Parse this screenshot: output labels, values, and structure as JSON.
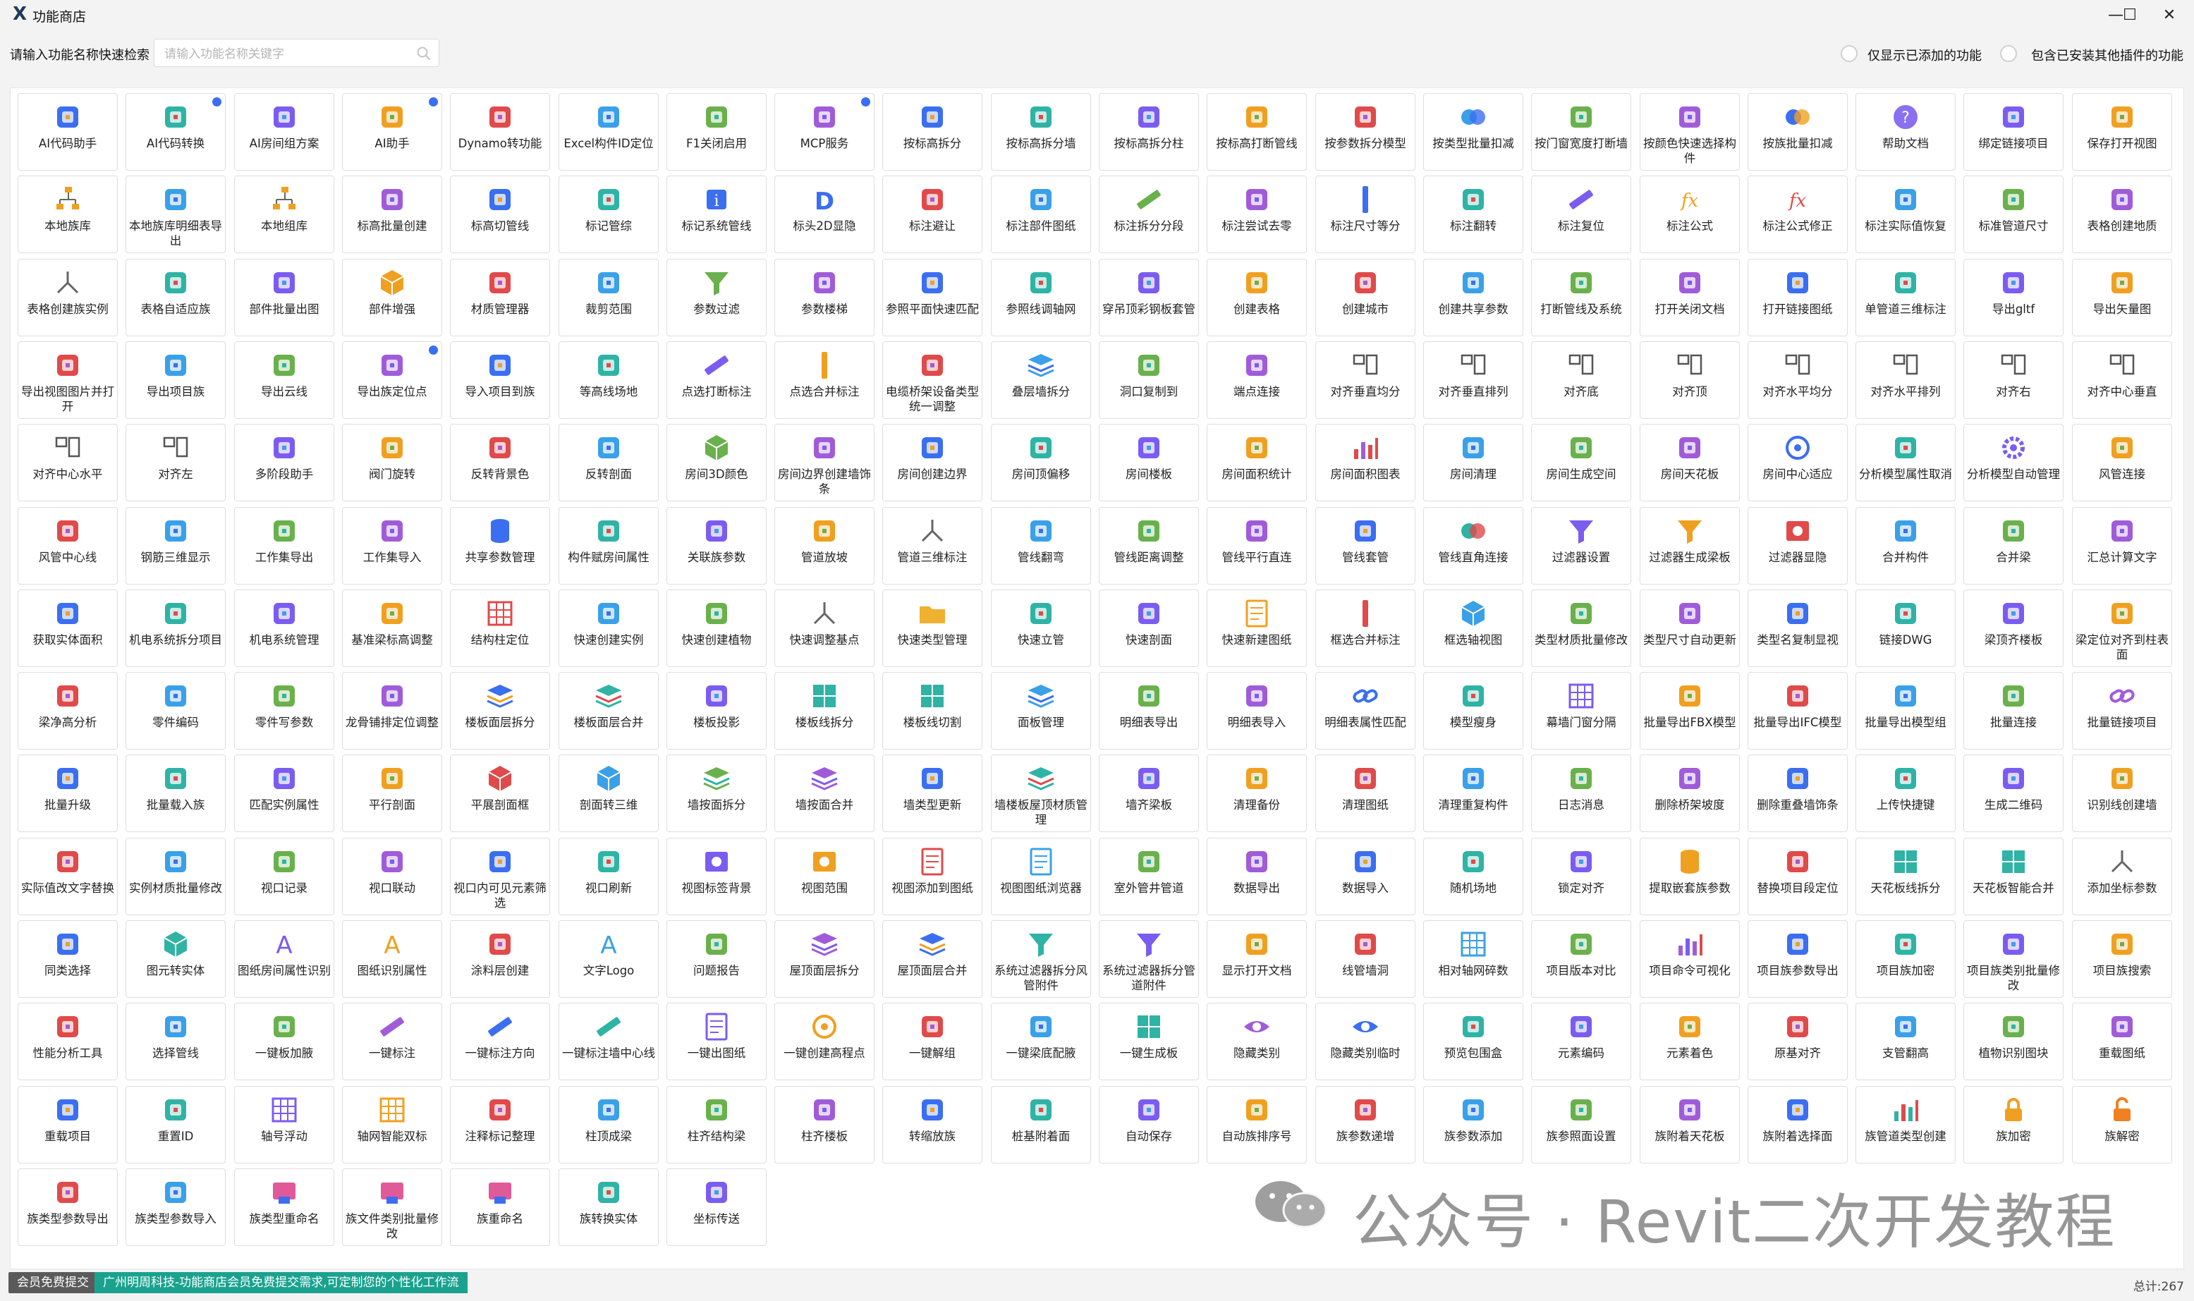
{
  "window": {
    "title": "功能商店",
    "logo": "X",
    "minimize_glyph": "—",
    "maximize_glyph": "☐",
    "close_glyph": "✕"
  },
  "search": {
    "label": "请输入功能名称快速检索",
    "placeholder": "请输入功能名称关键字",
    "value": ""
  },
  "filters": {
    "only_added": "仅显示已添加的功能",
    "include_other_plugins": "包含已安装其他插件的功能"
  },
  "colors": {
    "accent": "#3b6ef0",
    "status_green": "#1aa28f",
    "status_gray": "#5a5a5a"
  },
  "features": [
    {
      "label": "AI代码助手",
      "icon": "chat-robot-icon"
    },
    {
      "label": "AI代码转换",
      "icon": "code-window-icon",
      "badge": true
    },
    {
      "label": "AI房间组方案",
      "icon": "nodes-icon"
    },
    {
      "label": "AI助手",
      "icon": "robot-icon",
      "badge": true
    },
    {
      "label": "Dynamo转功能",
      "icon": "dynamo-icon"
    },
    {
      "label": "Excel构件ID定位",
      "icon": "spreadsheet-icon"
    },
    {
      "label": "F1关闭启用",
      "icon": "f1-key-icon"
    },
    {
      "label": "MCP服务",
      "icon": "mcp-nodes-icon",
      "badge": true
    },
    {
      "label": "按标高拆分",
      "icon": "grid-split-icon"
    },
    {
      "label": "按标高拆分墙",
      "icon": "gear-snow-icon"
    },
    {
      "label": "按标高拆分柱",
      "icon": "gear-snow-icon"
    },
    {
      "label": "按标高打断管线",
      "icon": "vertical-pipe-icon"
    },
    {
      "label": "按参数拆分模型",
      "icon": "cubes-icon"
    },
    {
      "label": "按类型批量扣减",
      "icon": "circles-icon"
    },
    {
      "label": "按门窗宽度打断墙",
      "icon": "door-wall-icon"
    },
    {
      "label": "按颜色快速选择构件",
      "icon": "color-wheel-icon"
    },
    {
      "label": "按族批量扣减",
      "icon": "circles-icon"
    },
    {
      "label": "帮助文档",
      "icon": "help-icon"
    },
    {
      "label": "绑定链接项目",
      "icon": "link-doc-icon"
    },
    {
      "label": "保存打开视图",
      "icon": "ram-icon"
    },
    {
      "label": "本地族库",
      "icon": "tree-icon"
    },
    {
      "label": "本地族库明细表导出",
      "icon": "table-export-icon"
    },
    {
      "label": "本地组库",
      "icon": "tree-icon"
    },
    {
      "label": "标高批量创建",
      "icon": "list-icon"
    },
    {
      "label": "标高切管线",
      "icon": "level-cut-icon"
    },
    {
      "label": "标记管综",
      "icon": "tag-grid-icon"
    },
    {
      "label": "标记系统管线",
      "icon": "info-icon"
    },
    {
      "label": "标头2D显隐",
      "icon": "letter-d-icon"
    },
    {
      "label": "标注避让",
      "icon": "dimension-icon"
    },
    {
      "label": "标注部件图纸",
      "icon": "purple-square-icon"
    },
    {
      "label": "标注拆分分段",
      "icon": "ruler-icon"
    },
    {
      "label": "标注尝试去零",
      "icon": "wave-icon"
    },
    {
      "label": "标注尺寸等分",
      "icon": "vertical-ruler-icon"
    },
    {
      "label": "标注翻转",
      "icon": "flip-icon"
    },
    {
      "label": "标注复位",
      "icon": "ruler-icon"
    },
    {
      "label": "标注公式",
      "icon": "fx-icon"
    },
    {
      "label": "标注公式修正",
      "icon": "fx-icon"
    },
    {
      "label": "标注实际值恢复",
      "icon": "shuffle-icon"
    },
    {
      "label": "标准管道尺寸",
      "icon": "gauge-icon"
    },
    {
      "label": "表格创建地质",
      "icon": "table-icon"
    },
    {
      "label": "表格创建族实例",
      "icon": "tripod-icon"
    },
    {
      "label": "表格自适应族",
      "icon": "table-x-icon"
    },
    {
      "label": "部件批量出图",
      "icon": "frame-icon"
    },
    {
      "label": "部件增强",
      "icon": "cube-icon"
    },
    {
      "label": "材质管理器",
      "icon": "material-icon"
    },
    {
      "label": "裁剪范围",
      "icon": "crop-icon"
    },
    {
      "label": "参数过滤",
      "icon": "filter-icon"
    },
    {
      "label": "参数楼梯",
      "icon": "stairs-icon"
    },
    {
      "label": "参照平面快速匹配",
      "icon": "hatch-icon"
    },
    {
      "label": "参照线调轴网",
      "icon": "list-icon"
    },
    {
      "label": "穿吊顶彩钢板套管",
      "icon": "compass-icon"
    },
    {
      "label": "创建表格",
      "icon": "xls-icon"
    },
    {
      "label": "创建城市",
      "icon": "map-icon"
    },
    {
      "label": "创建共享参数",
      "icon": "share-icon"
    },
    {
      "label": "打断管线及系统",
      "icon": "pin-icon"
    },
    {
      "label": "打开关闭文档",
      "icon": "door-exit-icon"
    },
    {
      "label": "打开链接图纸",
      "icon": "link-drawing-icon"
    },
    {
      "label": "单管道三维标注",
      "icon": "ladder-icon"
    },
    {
      "label": "导出gltf",
      "icon": "export-icon"
    },
    {
      "label": "导出矢量图",
      "icon": "camera-icon"
    },
    {
      "label": "导出视图图片并打开",
      "icon": "image-icon"
    },
    {
      "label": "导出项目族",
      "icon": "box-icon"
    },
    {
      "label": "导出云线",
      "icon": "cloud-upload-icon"
    },
    {
      "label": "导出族定位点",
      "icon": "dots-icon",
      "badge": true
    },
    {
      "label": "导入项目到族",
      "icon": "import-icon"
    },
    {
      "label": "等高线场地",
      "icon": "contour-icon"
    },
    {
      "label": "点选打断标注",
      "icon": "ruler-icon"
    },
    {
      "label": "点选合并标注",
      "icon": "vertical-ruler-icon"
    },
    {
      "label": "电缆桥架设备类型统一调整",
      "icon": "hammer-icon"
    },
    {
      "label": "叠层墙拆分",
      "icon": "layers-icon"
    },
    {
      "label": "洞口复制到",
      "icon": "dashed-square-icon"
    },
    {
      "label": "端点连接",
      "icon": "t-bar-icon"
    },
    {
      "label": "对齐垂直均分",
      "icon": "align-icon"
    },
    {
      "label": "对齐垂直排列",
      "icon": "align-icon"
    },
    {
      "label": "对齐底",
      "icon": "align-icon"
    },
    {
      "label": "对齐顶",
      "icon": "align-icon"
    },
    {
      "label": "对齐水平均分",
      "icon": "align-icon"
    },
    {
      "label": "对齐水平排列",
      "icon": "align-icon"
    },
    {
      "label": "对齐右",
      "icon": "align-icon"
    },
    {
      "label": "对齐中心垂直",
      "icon": "align-icon"
    },
    {
      "label": "对齐中心水平",
      "icon": "align-icon"
    },
    {
      "label": "对齐左",
      "icon": "align-icon"
    },
    {
      "label": "多阶段助手",
      "icon": "stack-icon"
    },
    {
      "label": "阀门旋转",
      "icon": "valve-icon"
    },
    {
      "label": "反转背景色",
      "icon": "contrast-icon"
    },
    {
      "label": "反转剖面",
      "icon": "bowtie-icon"
    },
    {
      "label": "房间3D颜色",
      "icon": "cube-icon"
    },
    {
      "label": "房间边界创建墙饰条",
      "icon": "room-icon"
    },
    {
      "label": "房间创建边界",
      "icon": "square-outline-icon"
    },
    {
      "label": "房间顶偏移",
      "icon": "chevron-up-icon"
    },
    {
      "label": "房间楼板",
      "icon": "room-icon"
    },
    {
      "label": "房间面积统计",
      "icon": "clipboard-icon"
    },
    {
      "label": "房间面积图表",
      "icon": "chart-icon"
    },
    {
      "label": "房间清理",
      "icon": "brush-icon"
    },
    {
      "label": "房间生成空间",
      "icon": "space-icon"
    },
    {
      "label": "房间天花板",
      "icon": "room-icon"
    },
    {
      "label": "房间中心适应",
      "icon": "target-icon"
    },
    {
      "label": "分析模型属性取消",
      "icon": "x-box-icon"
    },
    {
      "label": "分析模型自动管理",
      "icon": "gear-icon"
    },
    {
      "label": "风管连接",
      "icon": "t-bar-icon"
    },
    {
      "label": "风管中心线",
      "icon": "panel-icon"
    },
    {
      "label": "钢筋三维显示",
      "icon": "rebar-icon"
    },
    {
      "label": "工作集导出",
      "icon": "wrench-icon"
    },
    {
      "label": "工作集导入",
      "icon": "wrench-icon"
    },
    {
      "label": "共享参数管理",
      "icon": "database-icon"
    },
    {
      "label": "构件赋房间属性",
      "icon": "house-icon"
    },
    {
      "label": "关联族参数",
      "icon": "calc-icon"
    },
    {
      "label": "管道放坡",
      "icon": "slope-icon"
    },
    {
      "label": "管道三维标注",
      "icon": "tripod-icon"
    },
    {
      "label": "管线翻弯",
      "icon": "bend-icon"
    },
    {
      "label": "管线距离调整",
      "icon": "distance-icon"
    },
    {
      "label": "管线平行直连",
      "icon": "navigate-icon"
    },
    {
      "label": "管线套管",
      "icon": "ring-icon"
    },
    {
      "label": "管线直角连接",
      "icon": "circles-icon"
    },
    {
      "label": "过滤器设置",
      "icon": "filter-icon"
    },
    {
      "label": "过滤器生成梁板",
      "icon": "filter-icon"
    },
    {
      "label": "过滤器显隐",
      "icon": "view-icon"
    },
    {
      "label": "合并构件",
      "icon": "merge-icon"
    },
    {
      "label": "合并梁",
      "icon": "beam-icon"
    },
    {
      "label": "汇总计算文字",
      "icon": "book-icon"
    },
    {
      "label": "获取实体面积",
      "icon": "hatch-icon"
    },
    {
      "label": "机电系统拆分项目",
      "icon": "modules-icon"
    },
    {
      "label": "机电系统管理",
      "icon": "system-icon"
    },
    {
      "label": "基准梁标高调整",
      "icon": "arrow-down-icon"
    },
    {
      "label": "结构柱定位",
      "icon": "grid-icon"
    },
    {
      "label": "快速创建实例",
      "icon": "dots-icon"
    },
    {
      "label": "快速创建植物",
      "icon": "plant-icon"
    },
    {
      "label": "快速调整基点",
      "icon": "tripod-icon"
    },
    {
      "label": "快速类型管理",
      "icon": "folder-icon"
    },
    {
      "label": "快速立管",
      "icon": "pipe-icon"
    },
    {
      "label": "快速剖面",
      "icon": "section-icon"
    },
    {
      "label": "快速新建图纸",
      "icon": "sheet-icon"
    },
    {
      "label": "框选合并标注",
      "icon": "vertical-ruler-icon"
    },
    {
      "label": "框选轴视图",
      "icon": "cube-icon"
    },
    {
      "label": "类型材质批量修改",
      "icon": "triangles-icon"
    },
    {
      "label": "类型尺寸自动更新",
      "icon": "monitor-icon"
    },
    {
      "label": "类型名复制显视",
      "icon": "copy-icon"
    },
    {
      "label": "链接DWG",
      "icon": "dwg-icon"
    },
    {
      "label": "梁顶齐楼板",
      "icon": "beam-icon"
    },
    {
      "label": "梁定位对齐到柱表面",
      "icon": "column-icon"
    },
    {
      "label": "梁净高分析",
      "icon": "height-icon"
    },
    {
      "label": "零件编码",
      "icon": "compass-icon"
    },
    {
      "label": "零件写参数",
      "icon": "compass-icon"
    },
    {
      "label": "龙骨铺排定位调整",
      "icon": "diamond-arrow-icon"
    },
    {
      "label": "楼板面层拆分",
      "icon": "layers-icon"
    },
    {
      "label": "楼板面层合并",
      "icon": "layers-icon"
    },
    {
      "label": "楼板投影",
      "icon": "compass-icon"
    },
    {
      "label": "楼板线拆分",
      "icon": "slab-icon"
    },
    {
      "label": "楼板线切割",
      "icon": "slab-icon"
    },
    {
      "label": "面板管理",
      "icon": "layers-icon"
    },
    {
      "label": "明细表导出",
      "icon": "excel-icon"
    },
    {
      "label": "明细表导入",
      "icon": "excel-icon"
    },
    {
      "label": "明细表属性匹配",
      "icon": "link-icon"
    },
    {
      "label": "模型瘦身",
      "icon": "brush-icon"
    },
    {
      "label": "幕墙门窗分隔",
      "icon": "grid-icon"
    },
    {
      "label": "批量导出FBX模型",
      "icon": "doc-export-icon"
    },
    {
      "label": "批量导出IFC模型",
      "icon": "doc-export-icon"
    },
    {
      "label": "批量导出模型组",
      "icon": "group-icon"
    },
    {
      "label": "批量连接",
      "icon": "pentagon-icon"
    },
    {
      "label": "批量链接项目",
      "icon": "link-icon"
    },
    {
      "label": "批量升级",
      "icon": "upgrade-icon"
    },
    {
      "label": "批量载入族",
      "icon": "download-icon"
    },
    {
      "label": "匹配实例属性",
      "icon": "paintbrush-icon"
    },
    {
      "label": "平行剖面",
      "icon": "parallel-icon"
    },
    {
      "label": "平展剖面框",
      "icon": "cube-icon"
    },
    {
      "label": "剖面转三维",
      "icon": "cube-icon"
    },
    {
      "label": "墙按面拆分",
      "icon": "layers-icon"
    },
    {
      "label": "墙按面合并",
      "icon": "layers-icon"
    },
    {
      "label": "墙类型更新",
      "icon": "wall-icon"
    },
    {
      "label": "墙楼板屋顶材质管理",
      "icon": "layers-icon"
    },
    {
      "label": "墙齐梁板",
      "icon": "bars-icon"
    },
    {
      "label": "清理备份",
      "icon": "monitor-icon"
    },
    {
      "label": "清理图纸",
      "icon": "broom-icon"
    },
    {
      "label": "清理重复构件",
      "icon": "refresh-icon"
    },
    {
      "label": "日志消息",
      "icon": "log-icon"
    },
    {
      "label": "删除桥架坡度",
      "icon": "arrow-circle-icon"
    },
    {
      "label": "删除重叠墙饰条",
      "icon": "trash-icon"
    },
    {
      "label": "上传快捷键",
      "icon": "keyboard-icon"
    },
    {
      "label": "生成二维码",
      "icon": "qrcode-icon"
    },
    {
      "label": "识别线创建墙",
      "icon": "brick-icon"
    },
    {
      "label": "实际值改文字替换",
      "icon": "shuffle-icon"
    },
    {
      "label": "实例材质批量修改",
      "icon": "triangles-icon"
    },
    {
      "label": "视口记录",
      "icon": "viewport-icon"
    },
    {
      "label": "视口联动",
      "icon": "viewport-icon"
    },
    {
      "label": "视口内可见元素筛选",
      "icon": "viewport-icon"
    },
    {
      "label": "视口刷新",
      "icon": "viewport-icon"
    },
    {
      "label": "视图标签背景",
      "icon": "view-icon"
    },
    {
      "label": "视图范围",
      "icon": "view-icon"
    },
    {
      "label": "视图添加到图纸",
      "icon": "sheet-icon"
    },
    {
      "label": "视图图纸浏览器",
      "icon": "sheet-icon"
    },
    {
      "label": "室外管井管道",
      "icon": "well-icon"
    },
    {
      "label": "数据导出",
      "icon": "share-export-icon"
    },
    {
      "label": "数据导入",
      "icon": "share-import-icon"
    },
    {
      "label": "随机场地",
      "icon": "terrain-icon"
    },
    {
      "label": "锁定对齐",
      "icon": "lock-align-icon"
    },
    {
      "label": "提取嵌套族参数",
      "icon": "database-icon"
    },
    {
      "label": "替换项目段定位",
      "icon": "dots-icon"
    },
    {
      "label": "天花板线拆分",
      "icon": "slab-icon"
    },
    {
      "label": "天花板智能合并",
      "icon": "slab-icon"
    },
    {
      "label": "添加坐标参数",
      "icon": "tripod-icon"
    },
    {
      "label": "同类选择",
      "icon": "select-icon"
    },
    {
      "label": "图元转实体",
      "icon": "cube-icon"
    },
    {
      "label": "图纸房间属性识别",
      "icon": "letter-a-icon"
    },
    {
      "label": "图纸识别属性",
      "icon": "letter-a-icon"
    },
    {
      "label": "涂料层创建",
      "icon": "paint-roller-icon"
    },
    {
      "label": "文字Logo",
      "icon": "letter-a-icon"
    },
    {
      "label": "问题报告",
      "icon": "report-icon"
    },
    {
      "label": "屋顶面层拆分",
      "icon": "layers-icon"
    },
    {
      "label": "屋顶面层合并",
      "icon": "layers-icon"
    },
    {
      "label": "系统过滤器拆分风管附件",
      "icon": "filter-icon"
    },
    {
      "label": "系统过滤器拆分管道附件",
      "icon": "filter-icon"
    },
    {
      "label": "显示打开文档",
      "icon": "open-doc-icon"
    },
    {
      "label": "线管墙洞",
      "icon": "monitor-icon"
    },
    {
      "label": "相对轴网碎数",
      "icon": "grid-icon"
    },
    {
      "label": "项目版本对比",
      "icon": "compare-icon"
    },
    {
      "label": "项目命令可视化",
      "icon": "chart-icon"
    },
    {
      "label": "项目族参数导出",
      "icon": "export-icon"
    },
    {
      "label": "项目族加密",
      "icon": "lock-doc-icon"
    },
    {
      "label": "项目族类别批量修改",
      "icon": "diamond-icon"
    },
    {
      "label": "项目族搜索",
      "icon": "search-doc-icon"
    },
    {
      "label": "性能分析工具",
      "icon": "analysis-icon"
    },
    {
      "label": "选择管线",
      "icon": "select-pipe-icon"
    },
    {
      "label": "一键板加腋",
      "icon": "triangle-icon"
    },
    {
      "label": "一键标注",
      "icon": "ruler-icon"
    },
    {
      "label": "一键标注方向",
      "icon": "ruler-icon"
    },
    {
      "label": "一键标注墙中心线",
      "icon": "ruler-icon"
    },
    {
      "label": "一键出图纸",
      "icon": "sheet-icon"
    },
    {
      "label": "一键创建高程点",
      "icon": "target-icon"
    },
    {
      "label": "一键解组",
      "icon": "ungroup-icon"
    },
    {
      "label": "一键梁底配腋",
      "icon": "beam-icon"
    },
    {
      "label": "一键生成板",
      "icon": "slab-icon"
    },
    {
      "label": "隐藏类别",
      "icon": "eye-icon"
    },
    {
      "label": "隐藏类别临时",
      "icon": "eye-icon"
    },
    {
      "label": "预览包围盒",
      "icon": "box-icon"
    },
    {
      "label": "元素编码",
      "icon": "code-box-icon"
    },
    {
      "label": "元素着色",
      "icon": "palette-icon"
    },
    {
      "label": "原基对齐",
      "icon": "crosshair-icon"
    },
    {
      "label": "支管翻高",
      "icon": "branch-icon"
    },
    {
      "label": "植物识别图块",
      "icon": "tree-plant-icon"
    },
    {
      "label": "重载图纸",
      "icon": "reload-icon"
    },
    {
      "label": "重载项目",
      "icon": "reload-icon"
    },
    {
      "label": "重置ID",
      "icon": "fingerprint-icon"
    },
    {
      "label": "轴号浮动",
      "icon": "grid-icon"
    },
    {
      "label": "轴网智能双标",
      "icon": "grid-icon"
    },
    {
      "label": "注释标记整理",
      "icon": "tag-icon"
    },
    {
      "label": "柱顶成梁",
      "icon": "column-icon"
    },
    {
      "label": "柱齐结构梁",
      "icon": "height-icon"
    },
    {
      "label": "柱齐楼板",
      "icon": "height-icon"
    },
    {
      "label": "转缩放族",
      "icon": "scale-icon"
    },
    {
      "label": "桩基附着面",
      "icon": "pile-icon"
    },
    {
      "label": "自动保存",
      "icon": "save-icon"
    },
    {
      "label": "自动族排序号",
      "icon": "braces-icon"
    },
    {
      "label": "族参数递增",
      "icon": "plus-box-icon"
    },
    {
      "label": "族参数添加",
      "icon": "folder-add-icon"
    },
    {
      "label": "族参照面设置",
      "icon": "plane-icon"
    },
    {
      "label": "族附着天花板",
      "icon": "attach-icon"
    },
    {
      "label": "族附着选择面",
      "icon": "attach-icon"
    },
    {
      "label": "族管道类型创建",
      "icon": "chart-icon"
    },
    {
      "label": "族加密",
      "icon": "lock-icon"
    },
    {
      "label": "族解密",
      "icon": "unlock-icon"
    },
    {
      "label": "族类型参数导出",
      "icon": "arrow-up-circle-icon"
    },
    {
      "label": "族类型参数导入",
      "icon": "arrow-down-circle-icon"
    },
    {
      "label": "族类型重命名",
      "icon": "rename-icon"
    },
    {
      "label": "族文件类别批量修改",
      "icon": "rename-icon"
    },
    {
      "label": "族重命名",
      "icon": "rename-icon"
    },
    {
      "label": "族转换实体",
      "icon": "convert-icon"
    },
    {
      "label": "坐标传送",
      "icon": "coord-icon"
    }
  ],
  "watermark": {
    "text": "公众号 · Revit二次开发教程",
    "icon": "wechat-icon"
  },
  "status": {
    "free_badge": "会员免费提交",
    "message": "广州明周科技-功能商店会员免费提交需求,可定制您的个性化工作流",
    "total": "总计:267"
  }
}
